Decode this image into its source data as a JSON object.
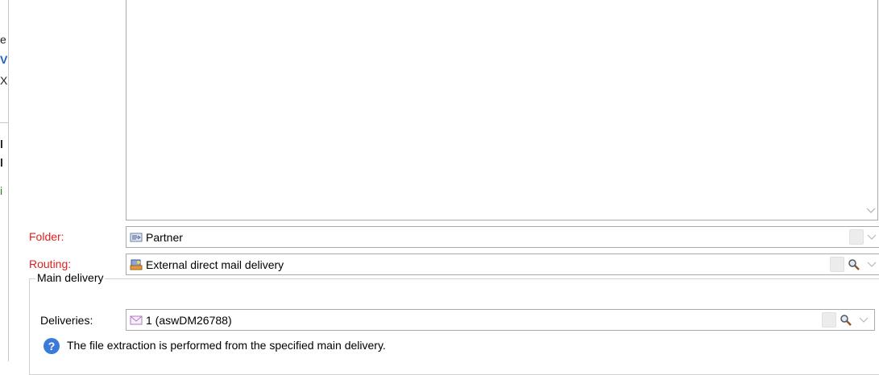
{
  "left_panel_fragments": [
    "e",
    "V",
    "X",
    "l",
    "l",
    "i"
  ],
  "folder": {
    "label": "Folder:",
    "value": "Partner",
    "icon": "folder-partner-icon"
  },
  "routing": {
    "label": "Routing:",
    "value": "External direct mail delivery",
    "icon": "mail-routing-icon"
  },
  "main_delivery": {
    "title": "Main delivery",
    "deliveries_label": "Deliveries:",
    "deliveries_value": "1 (aswDM26788)",
    "help_text": "The file extraction is performed from the specified main delivery."
  },
  "colors": {
    "required_label": "#e02020",
    "help_icon": "#3b7ad8"
  }
}
